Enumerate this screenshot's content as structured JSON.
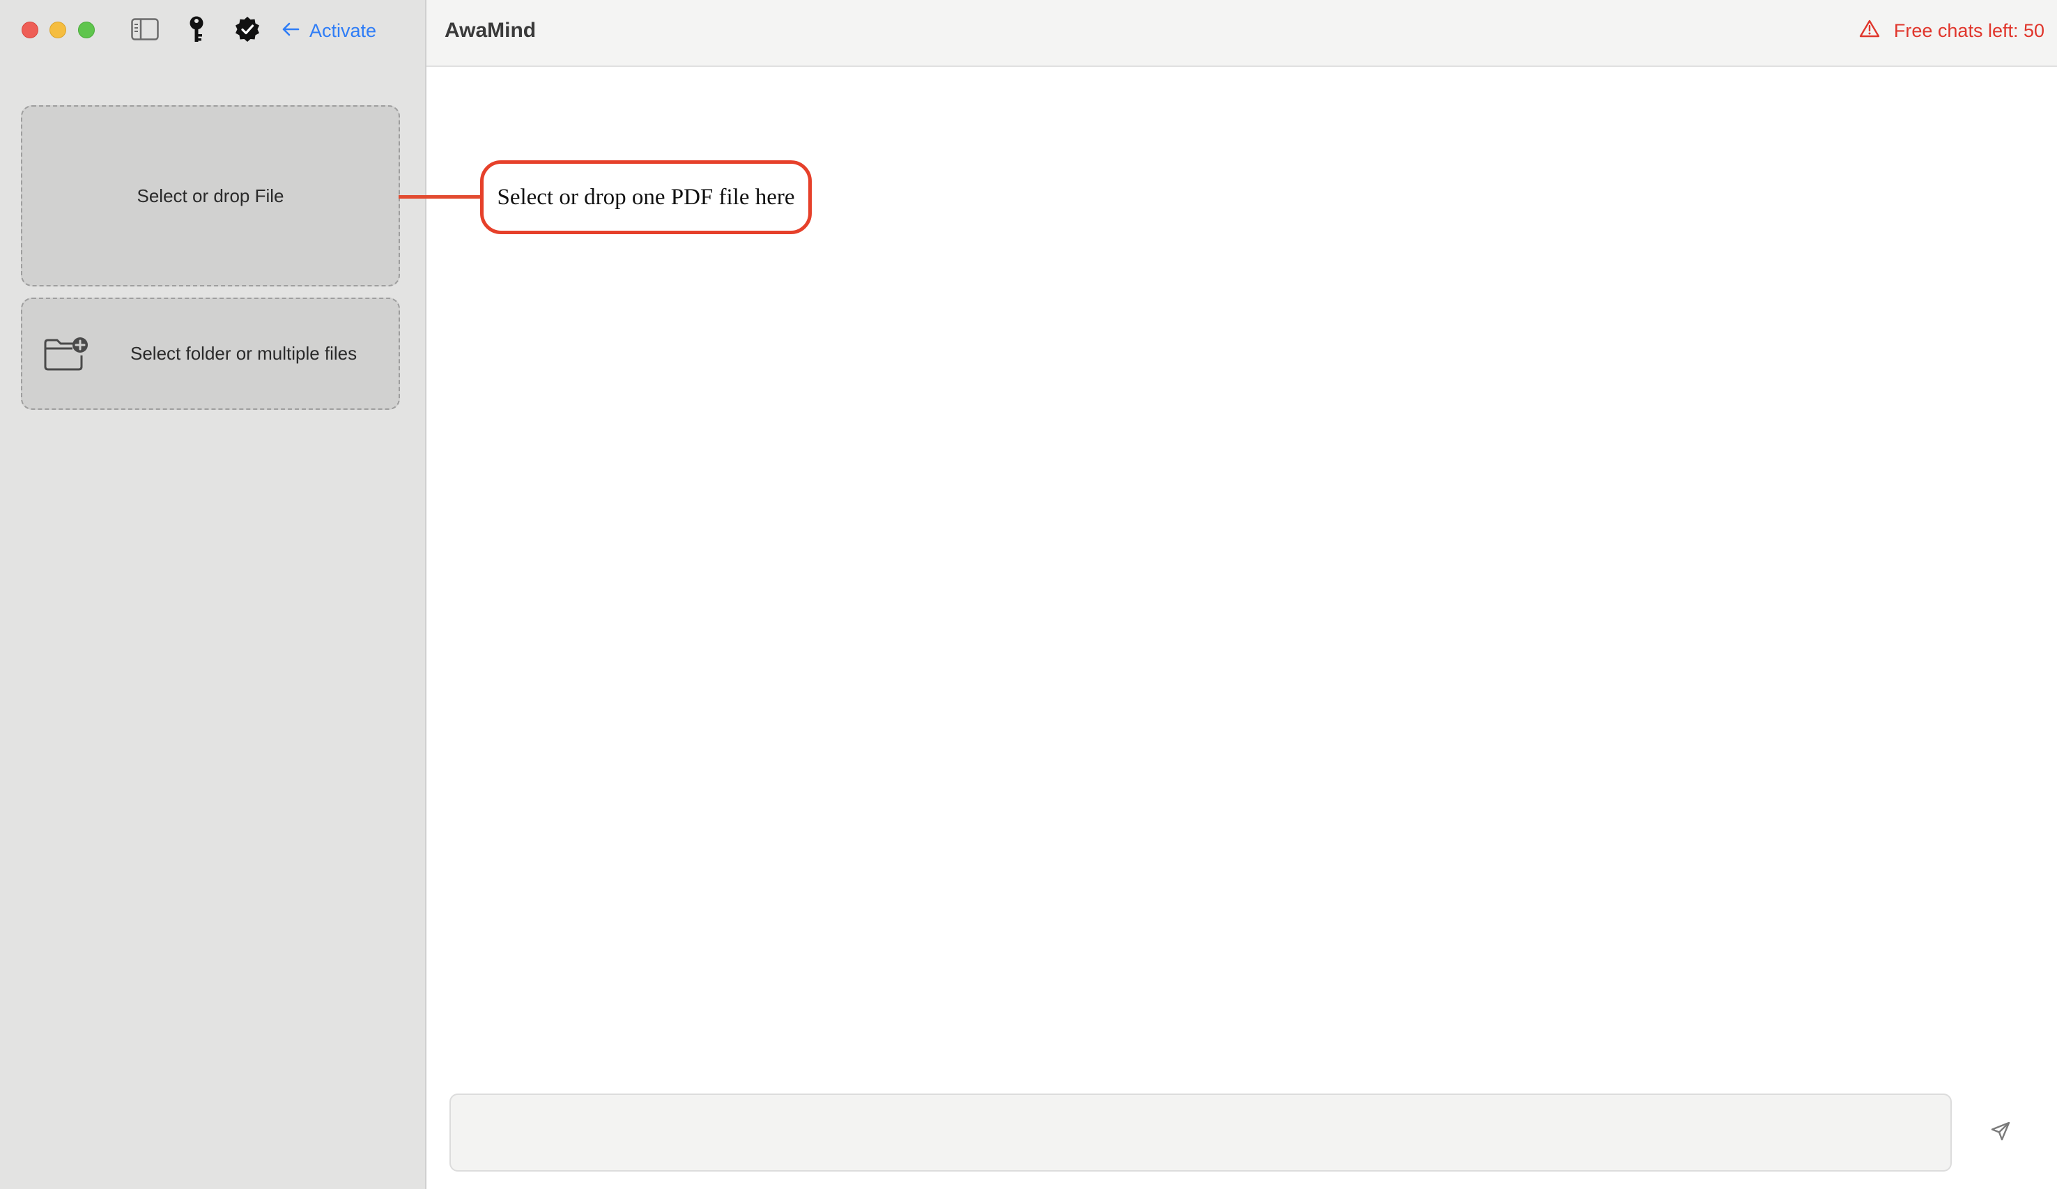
{
  "window": {
    "controls": [
      "close",
      "minimize",
      "zoom"
    ]
  },
  "toolbar": {
    "icons": [
      "sidebar-toggle-icon",
      "key-icon",
      "verified-badge-icon"
    ],
    "activate_label": "Activate",
    "activate_icon": "arrow-left-icon"
  },
  "sidebar": {
    "drop_file_label": "Select or drop File",
    "select_folder_label": "Select folder or multiple files",
    "select_folder_icon": "folder-plus-icon"
  },
  "header": {
    "title": "AwaMind",
    "free_chats_label": "Free chats left: 50",
    "warning_icon": "warning-triangle-icon"
  },
  "callout": {
    "text": "Select or drop one PDF file here"
  },
  "chat": {
    "input_value": "",
    "input_placeholder": "",
    "send_icon": "send-icon"
  },
  "colors": {
    "accent_blue": "#2f7df6",
    "warning_red": "#e0362c",
    "callout_red": "#e6402a",
    "sidebar_bg": "#e3e3e2"
  }
}
